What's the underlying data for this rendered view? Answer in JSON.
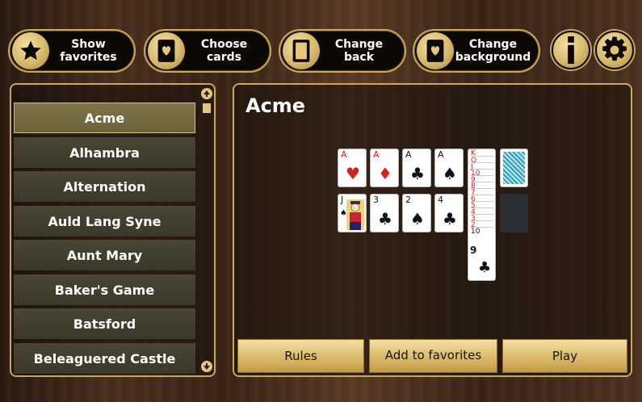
{
  "toolbar": {
    "show_favorites": "Show\nfavorites",
    "choose_cards": "Choose cards",
    "change_back": "Change back",
    "change_background": "Change\nbackground"
  },
  "game_list": {
    "items": [
      "Acme",
      "Alhambra",
      "Alternation",
      "Auld Lang Syne",
      "Aunt Mary",
      "Baker's Game",
      "Batsford",
      "Beleaguered Castle"
    ],
    "selected": "Acme"
  },
  "detail": {
    "title": "Acme",
    "rules_label": "Rules",
    "favorites_label": "Add to favorites",
    "play_label": "Play"
  },
  "preview": {
    "row1": [
      {
        "rank": "A",
        "suit": "♥",
        "color": "red"
      },
      {
        "rank": "A",
        "suit": "♦",
        "color": "red"
      },
      {
        "rank": "A",
        "suit": "♣",
        "color": "blk"
      },
      {
        "rank": "A",
        "suit": "♠",
        "color": "blk"
      }
    ],
    "row2": [
      {
        "rank": "J",
        "suit": "♠",
        "color": "blk"
      },
      {
        "rank": "3",
        "suit": "♣",
        "color": "blk"
      },
      {
        "rank": "2",
        "suit": "♠",
        "color": "blk"
      },
      {
        "rank": "4",
        "suit": "♣",
        "color": "blk"
      }
    ],
    "cascade_ranks": [
      "K",
      "Q",
      "J",
      "10",
      "9",
      "8",
      "7",
      "6",
      "5",
      "4",
      "3",
      "2",
      "10"
    ],
    "cascade_bottom": {
      "rank": "9",
      "suit": "♣"
    }
  },
  "colors": {
    "gold": "#c9a85a",
    "button_fill": "#0b0806",
    "list_item": "#3b382a",
    "list_selected": "#6b6139"
  }
}
